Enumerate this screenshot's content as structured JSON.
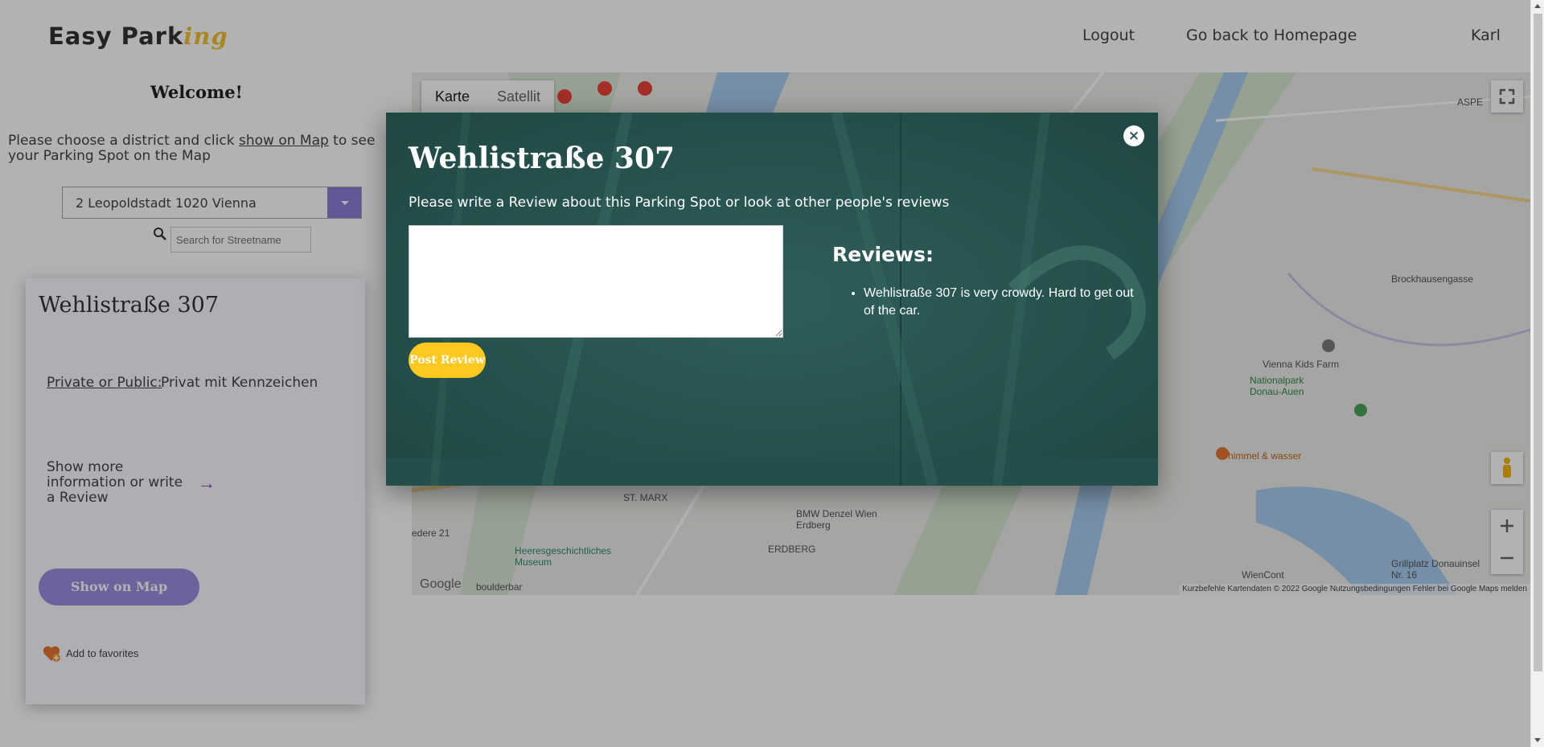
{
  "header": {
    "logo_main": "Easy Park",
    "logo_accent": "ing",
    "logout": "Logout",
    "homepage": "Go back to Homepage",
    "user": "Karl"
  },
  "sidebar": {
    "welcome": "Welcome!",
    "intro_before": "Please choose a district and click ",
    "intro_link": "show on Map",
    "intro_after": " to see your Parking Spot on the Map",
    "district_value": "2 Leopoldstadt 1020 Vienna",
    "search_placeholder": "Search for Streetname"
  },
  "spot_card": {
    "title": "Wehlistraße 307",
    "private_public_label": "Private or Public:",
    "private_public_value": "Privat mit Kennzeichen",
    "more_info": "Show more information or write a Review",
    "show_on_map": "Show on Map",
    "add_favorites": "Add to favorites"
  },
  "map": {
    "tab_map": "Karte",
    "tab_satellite": "Satellit",
    "labels": [
      "ST. MARX",
      "ERDBERG",
      "BMW Denzel Wien Erdberg",
      "Heeresgeschichtliches Museum",
      "boulderbar",
      "Vienna Kids Farm",
      "Nationalpark Donau-Auen",
      "himmel & wasser",
      "Grillplatz Donauinsel Nr. 16",
      "WienCont",
      "Brockhausengasse",
      "ASPE",
      "edere 21",
      "Google"
    ],
    "footer": "Kurzbefehle   Kartendaten © 2022 Google   Nutzungsbedingungen   Fehler bei Google Maps melden"
  },
  "modal": {
    "title": "Wehlistraße 307",
    "subtitle": "Please write a Review about this Parking Spot or look at other people's reviews",
    "textarea_value": "",
    "post_button": "Post Review",
    "reviews_title": "Reviews:",
    "reviews": [
      "Wehlistraße 307 is very crowdy. Hard to get out of the car."
    ],
    "close": "×"
  },
  "colors": {
    "accent_purple": "#8b7fd6",
    "accent_yellow": "#ffc81e",
    "modal_bg": "#2a5653"
  }
}
